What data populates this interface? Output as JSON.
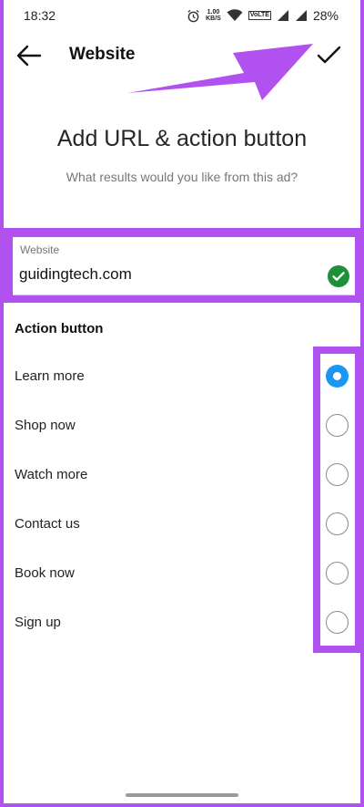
{
  "status_bar": {
    "time": "18:32",
    "net_speed_value": "1.00",
    "net_speed_unit": "KB/S",
    "network_badge": "VoLTE",
    "battery": "28%"
  },
  "app_bar": {
    "title": "Website"
  },
  "header": {
    "headline": "Add URL & action button",
    "subhead": "What results would you like from this ad?"
  },
  "website_field": {
    "label": "Website",
    "value": "guidingtech.com"
  },
  "action_button": {
    "section_title": "Action button",
    "selected_index": 0,
    "options": [
      {
        "label": "Learn more"
      },
      {
        "label": "Shop now"
      },
      {
        "label": "Watch more"
      },
      {
        "label": "Contact us"
      },
      {
        "label": "Book now"
      },
      {
        "label": "Sign up"
      }
    ]
  },
  "colors": {
    "highlight": "#b151f0",
    "radio_selected": "#1a97f0",
    "valid_check": "#1e8f3a"
  },
  "icons": {
    "back": "arrow-left-icon",
    "done": "checkmark-icon",
    "valid": "check-circle-icon"
  }
}
